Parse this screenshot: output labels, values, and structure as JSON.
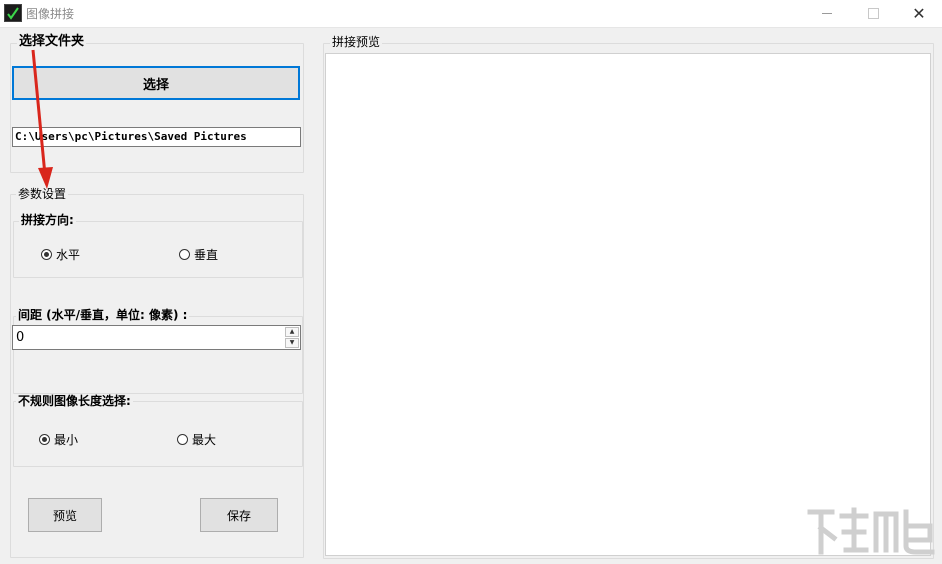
{
  "window": {
    "title": "图像拼接",
    "close_glyph": "✕"
  },
  "folder_group": {
    "label": "选择文件夹",
    "select_button": "选择",
    "path_value": "C:\\Users\\pc\\Pictures\\Saved Pictures"
  },
  "params_group": {
    "label": "参数设置",
    "direction": {
      "label": "拼接方向:",
      "options": [
        "水平",
        "垂直"
      ],
      "selected": "水平"
    },
    "spacing": {
      "label": "间距 (水平/垂直，单位: 像素) :",
      "value": "0",
      "up_glyph": "▲",
      "down_glyph": "▼"
    },
    "irregular": {
      "label": "不规则图像长度选择:",
      "options": [
        "最小",
        "最大"
      ],
      "selected": "最小"
    },
    "preview_button": "预览",
    "save_button": "保存"
  },
  "preview": {
    "label": "拼接预览"
  },
  "colors": {
    "focus_border": "#0078d7",
    "annotation_arrow": "#d9261c"
  }
}
